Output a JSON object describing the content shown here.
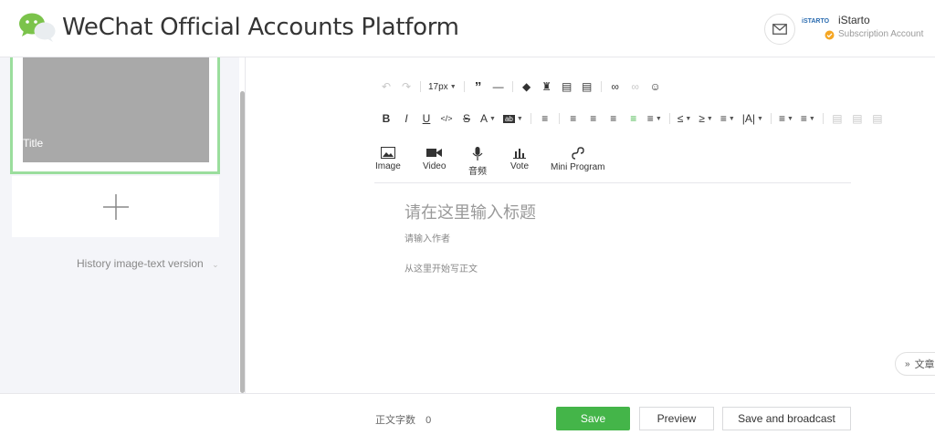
{
  "header": {
    "app_title": "WeChat Official Accounts Platform",
    "account_name": "iStarto",
    "account_type": "Subscription Account",
    "account_logo_text": "iSTARTO"
  },
  "sidebar": {
    "article_title": "Title",
    "history_label": "History image-text version"
  },
  "toolbar": {
    "font_size": "17px",
    "media": [
      {
        "label": "Image"
      },
      {
        "label": "Video"
      },
      {
        "label": "音频"
      },
      {
        "label": "Vote"
      },
      {
        "label": "Mini Program"
      }
    ]
  },
  "editor": {
    "title_placeholder": "请在这里输入标题",
    "author_placeholder": "请输入作者",
    "body_placeholder": "从这里开始写正文",
    "outline_button": "文章"
  },
  "footer": {
    "word_count_label": "正文字数",
    "word_count_value": "0",
    "save_label": "Save",
    "preview_label": "Preview",
    "broadcast_label": "Save and broadcast"
  },
  "colors": {
    "accent": "#44b549",
    "selected_border": "#9bde9d"
  }
}
